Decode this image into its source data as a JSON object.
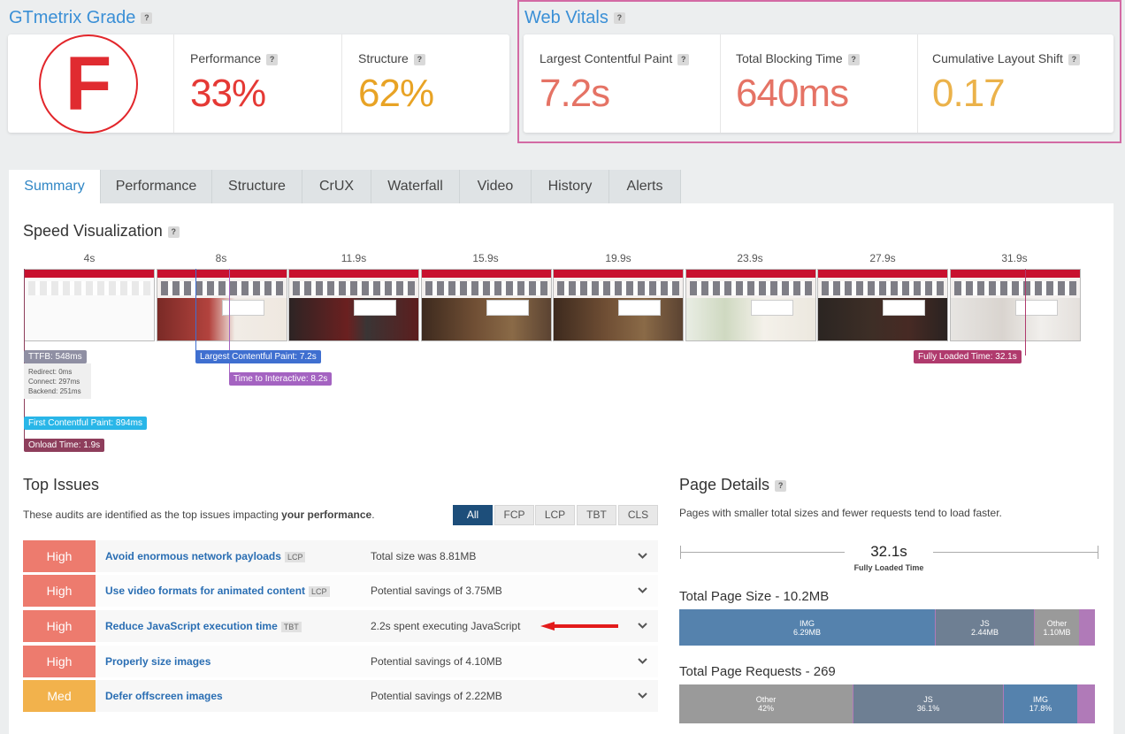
{
  "grade": {
    "title": "GTmetrix Grade",
    "help": "?",
    "letter": "F",
    "performance_label": "Performance",
    "performance_value": "33%",
    "structure_label": "Structure",
    "structure_value": "62%"
  },
  "vitals": {
    "title": "Web Vitals",
    "help": "?",
    "lcp_label": "Largest Contentful Paint",
    "lcp_value": "7.2s",
    "tbt_label": "Total Blocking Time",
    "tbt_value": "640ms",
    "cls_label": "Cumulative Layout Shift",
    "cls_value": "0.17"
  },
  "tabs": [
    "Summary",
    "Performance",
    "Structure",
    "CrUX",
    "Waterfall",
    "Video",
    "History",
    "Alerts"
  ],
  "speed": {
    "title": "Speed Visualization",
    "help": "?",
    "times": [
      "4s",
      "8s",
      "11.9s",
      "15.9s",
      "19.9s",
      "23.9s",
      "27.9s",
      "31.9s"
    ],
    "ttfb": "TTFB: 548ms",
    "redirect": "Redirect: 0ms",
    "connect": "Connect: 297ms",
    "backend": "Backend: 251ms",
    "lcp": "Largest Contentful Paint: 7.2s",
    "tti": "Time to Interactive: 8.2s",
    "fcp": "First Contentful Paint: 894ms",
    "onload": "Onload Time: 1.9s",
    "fully": "Fully Loaded Time: 32.1s"
  },
  "issues": {
    "title": "Top Issues",
    "intro": "These audits are identified as the top issues impacting ",
    "intro_bold": "your performance",
    "intro_end": ".",
    "filters": [
      "All",
      "FCP",
      "LCP",
      "TBT",
      "CLS"
    ],
    "rows": [
      {
        "severity": "High",
        "title": "Avoid enormous network payloads",
        "badge": "LCP",
        "desc": "Total size was 8.81MB"
      },
      {
        "severity": "High",
        "title": "Use video formats for animated content",
        "badge": "LCP",
        "desc": "Potential savings of 3.75MB"
      },
      {
        "severity": "High",
        "title": "Reduce JavaScript execution time",
        "badge": "TBT",
        "desc": "2.2s spent executing JavaScript"
      },
      {
        "severity": "High",
        "title": "Properly size images",
        "badge": "",
        "desc": "Potential savings of 4.10MB"
      },
      {
        "severity": "Med",
        "title": "Defer offscreen images",
        "badge": "",
        "desc": "Potential savings of 2.22MB"
      }
    ],
    "chevron": "⌄"
  },
  "details": {
    "title": "Page Details",
    "help": "?",
    "intro": "Pages with smaller total sizes and fewer requests tend to load faster.",
    "fully_value": "32.1s",
    "fully_label": "Fully Loaded Time",
    "size_title": "Total Page Size - 10.2MB",
    "size_segments": [
      {
        "label": "IMG",
        "value": "6.29MB",
        "fraction": 0.617,
        "color": "#5582ad"
      },
      {
        "label": "JS",
        "value": "2.44MB",
        "fraction": 0.239,
        "color": "#6e7f93"
      },
      {
        "label": "Other",
        "value": "1.10MB",
        "fraction": 0.108,
        "color": "#9a9a9a"
      }
    ],
    "requests_title": "Total Page Requests - 269",
    "req_segments": [
      {
        "label": "Other",
        "value": "42%",
        "fraction": 0.42,
        "color": "#9a9a9a"
      },
      {
        "label": "JS",
        "value": "36.1%",
        "fraction": 0.361,
        "color": "#6e7f93"
      },
      {
        "label": "IMG",
        "value": "17.8%",
        "fraction": 0.178,
        "color": "#5582ad"
      }
    ]
  },
  "colors": {
    "red": "#e53935",
    "orange": "#e8a325",
    "high": "#ed7b6e",
    "med": "#f2b24c",
    "accent": "#2f86c5",
    "highlight": "#d36aa4"
  }
}
